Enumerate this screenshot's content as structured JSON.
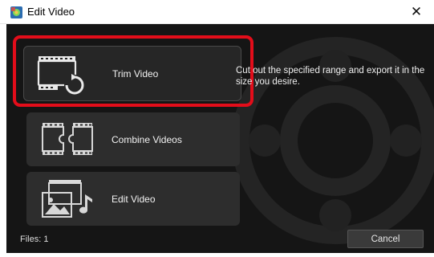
{
  "window": {
    "title": "Edit Video",
    "close_glyph": "✕"
  },
  "options": [
    {
      "label": "Trim Video",
      "icon": "film-rotate-icon",
      "selected": true
    },
    {
      "label": "Combine Videos",
      "icon": "puzzle-film-icon",
      "selected": false
    },
    {
      "label": "Edit Video",
      "icon": "media-music-icon",
      "selected": false
    }
  ],
  "description": "Cut out the specified range and export it in the size you desire.",
  "footer": {
    "files": "Files: 1",
    "cancel_label": "Cancel"
  },
  "colors": {
    "accent": "#e30d1a",
    "panel_bg": "#151515",
    "button_bg": "#2d2d2d"
  }
}
